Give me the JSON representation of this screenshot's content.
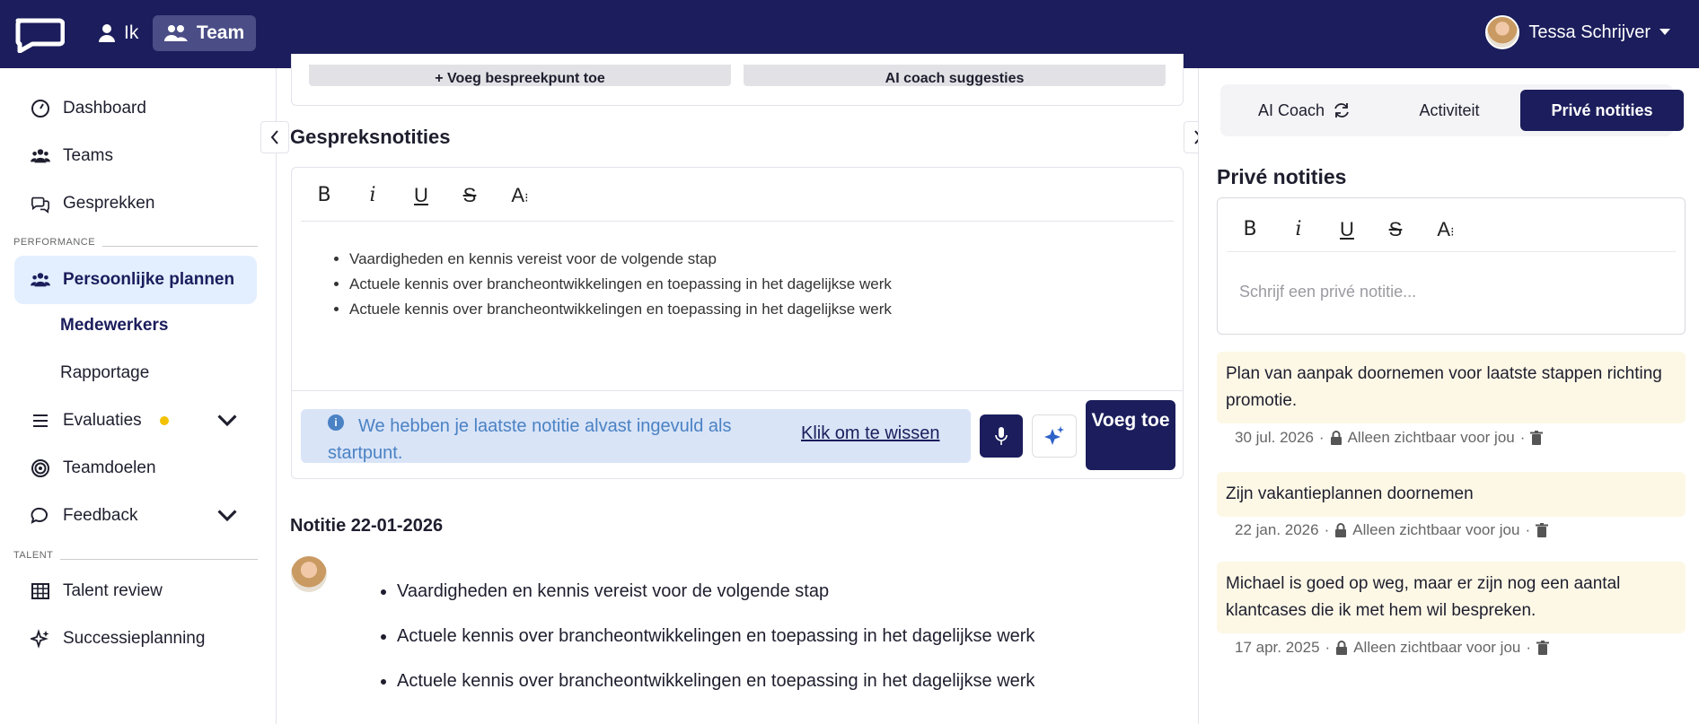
{
  "nav": {
    "me_label": "Ik",
    "team_label": "Team"
  },
  "user": {
    "name": "Tessa Schrijver"
  },
  "sidebar": {
    "dashboard": "Dashboard",
    "teams": "Teams",
    "gesprekken": "Gesprekken",
    "section_performance": "PERFORMANCE",
    "persoonlijke_plannen": "Persoonlijke plannen",
    "medewerkers": "Medewerkers",
    "rapportage": "Rapportage",
    "evaluaties": "Evaluaties",
    "teamdoelen": "Teamdoelen",
    "feedback": "Feedback",
    "section_talent": "TALENT",
    "talent_review": "Talent review",
    "successieplanning": "Successieplanning"
  },
  "main": {
    "add_point_button": "+ Voeg bespreekpunt toe",
    "ai_suggestions_button": "AI coach suggesties",
    "notes_title": "Gespreksnotities",
    "editor_bullets": [
      "Vaardigheden en kennis vereist voor de volgende stap",
      "Actuele kennis over brancheontwikkelingen en toepassing in het dagelijkse werk",
      "Actuele kennis over brancheontwikkelingen en toepassing in het dagelijkse werk"
    ],
    "info_text": "We hebben je laatste notitie alvast ingevuld als startpunt.",
    "info_link": "Klik om te wissen",
    "add_button": "Voeg toe",
    "note_date_title": "Notitie 22-01-2026",
    "note_bullets": [
      "Vaardigheden en kennis vereist voor de volgende stap",
      "Actuele kennis over brancheontwikkelingen en toepassing in het dagelijkse werk",
      "Actuele kennis over brancheontwikkelingen en toepassing in het dagelijkse werk"
    ]
  },
  "right": {
    "tab_ai": "AI Coach",
    "tab_activity": "Activiteit",
    "tab_private": "Privé notities",
    "title": "Privé notities",
    "placeholder": "Schrijf een privé notitie...",
    "notes": [
      {
        "text": "Plan van aanpak doornemen voor laatste stappen richting promotie.",
        "date": "30 jul. 2026",
        "visibility": "Alleen zichtbaar voor jou"
      },
      {
        "text": "Zijn vakantieplannen doornemen",
        "date": "22 jan. 2026",
        "visibility": "Alleen zichtbaar voor jou"
      },
      {
        "text": "Michael is goed op weg, maar er zijn nog een aantal klantcases die ik met hem wil bespreken.",
        "date": "17 apr. 2025",
        "visibility": "Alleen zichtbaar voor jou"
      }
    ]
  },
  "colors": {
    "brand": "#1b1d5c",
    "active_bg": "#e3efff",
    "info_bg": "#d9e4f7",
    "note_bg": "#fdf8e6",
    "badge_dot": "#f2c200"
  }
}
